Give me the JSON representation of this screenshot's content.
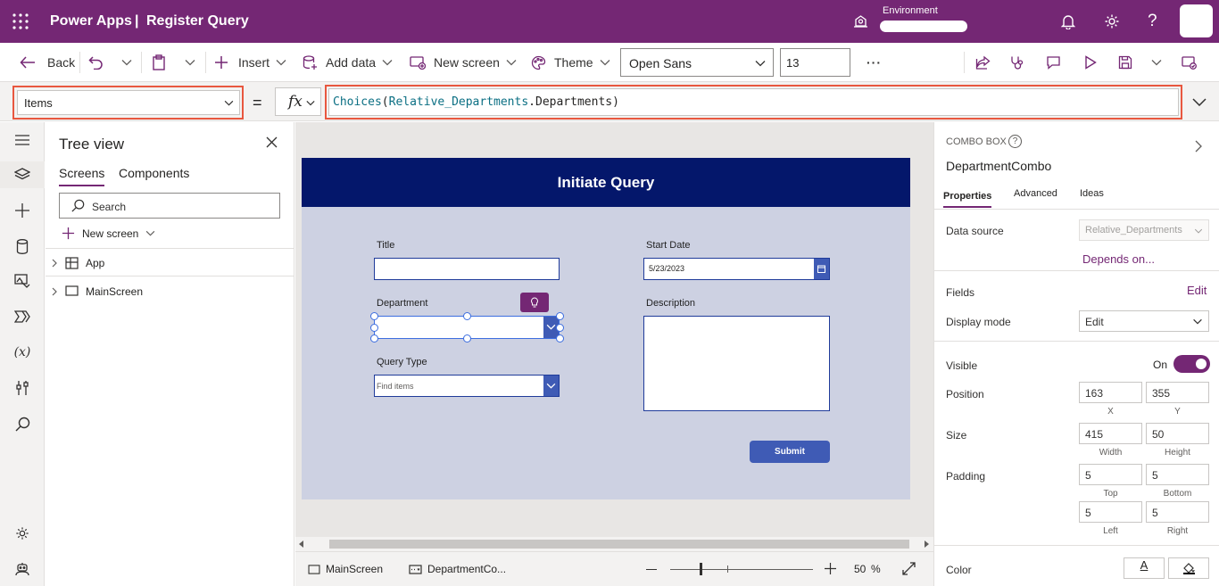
{
  "header": {
    "app_name": "Power Apps",
    "separator": "|",
    "app_title": "Register Query",
    "environment_label": "Environment"
  },
  "toolbar": {
    "back": "Back",
    "insert": "Insert",
    "add_data": "Add data",
    "new_screen": "New screen",
    "theme": "Theme",
    "font": "Open Sans",
    "font_size": "13",
    "more": "···"
  },
  "formula_bar": {
    "property": "Items",
    "equals": "=",
    "fx": "fx",
    "formula_func": "Choices",
    "formula_open": "(",
    "formula_source": "Relative_Departments",
    "formula_dot": ".",
    "formula_field": "Departments",
    "formula_close": ")"
  },
  "tree": {
    "title": "Tree view",
    "tabs": [
      "Screens",
      "Components"
    ],
    "search_placeholder": "Search",
    "new_screen": "New screen",
    "items": [
      "App",
      "MainScreen"
    ]
  },
  "form": {
    "header": "Initiate Query",
    "title_label": "Title",
    "start_date_label": "Start Date",
    "start_date_value": "5/23/2023",
    "department_label": "Department",
    "description_label": "Description",
    "query_type_label": "Query Type",
    "query_type_placeholder": "Find items",
    "submit": "Submit"
  },
  "bottom_bar": {
    "screen_tab": "MainScreen",
    "control_tab": "DepartmentCo...",
    "zoom_value": "50",
    "zoom_unit": "%",
    "zoom_fraction": 0.5
  },
  "properties_panel": {
    "control_type": "COMBO BOX",
    "control_name": "DepartmentCombo",
    "tabs": [
      "Properties",
      "Advanced",
      "Ideas"
    ],
    "data_source_label": "Data source",
    "data_source_value": "Relative_Departments",
    "depends_on": "Depends on...",
    "fields_label": "Fields",
    "fields_edit": "Edit",
    "display_mode_label": "Display mode",
    "display_mode_value": "Edit",
    "visible_label": "Visible",
    "visible_value": "On",
    "position_label": "Position",
    "position_x": "163",
    "position_y": "355",
    "x_label": "X",
    "y_label": "Y",
    "size_label": "Size",
    "width": "415",
    "height": "50",
    "width_label": "Width",
    "height_label": "Height",
    "padding_label": "Padding",
    "pad_top": "5",
    "pad_bottom": "5",
    "pad_left": "5",
    "pad_right": "5",
    "top_label": "Top",
    "bottom_label": "Bottom",
    "left_label": "Left",
    "right_label": "Right",
    "color_label": "Color",
    "color_text_glyph": "A"
  },
  "colors": {
    "header": "#742774",
    "screen_header": "#04176b",
    "accent": "#3f5bb5",
    "highlight": "#e8573f",
    "formula_func": "#0b6f83"
  }
}
